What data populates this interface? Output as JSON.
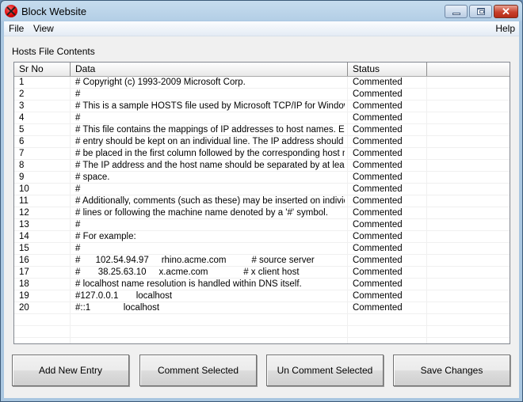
{
  "window": {
    "title": "Block Website",
    "icon": "block-icon",
    "controls": [
      "minimize-icon",
      "maximize-icon",
      "close-icon"
    ]
  },
  "menu": {
    "file": "File",
    "view": "View",
    "help": "Help"
  },
  "group_label": "Hosts File Contents",
  "table": {
    "columns": [
      "Sr No",
      "Data",
      "Status",
      ""
    ],
    "rows": [
      {
        "sr": "1",
        "data": "# Copyright (c) 1993-2009 Microsoft Corp.",
        "status": "Commented"
      },
      {
        "sr": "2",
        "data": "#",
        "status": "Commented"
      },
      {
        "sr": "3",
        "data": "# This is a sample HOSTS file used by Microsoft TCP/IP for Windows.",
        "status": "Commented"
      },
      {
        "sr": "4",
        "data": "#",
        "status": "Commented"
      },
      {
        "sr": "5",
        "data": "# This file contains the mappings of IP addresses to host names. Each",
        "status": "Commented"
      },
      {
        "sr": "6",
        "data": "# entry should be kept on an individual line. The IP address should",
        "status": "Commented"
      },
      {
        "sr": "7",
        "data": "# be placed in the first column followed by the corresponding host na...",
        "status": "Commented"
      },
      {
        "sr": "8",
        "data": "# The IP address and the host name should be separated by at least ...",
        "status": "Commented"
      },
      {
        "sr": "9",
        "data": "# space.",
        "status": "Commented"
      },
      {
        "sr": "10",
        "data": "#",
        "status": "Commented"
      },
      {
        "sr": "11",
        "data": "# Additionally, comments (such as these) may be inserted on individual",
        "status": "Commented"
      },
      {
        "sr": "12",
        "data": "# lines or following the machine name denoted by a '#' symbol.",
        "status": "Commented"
      },
      {
        "sr": "13",
        "data": "#",
        "status": "Commented"
      },
      {
        "sr": "14",
        "data": "# For example:",
        "status": "Commented"
      },
      {
        "sr": "15",
        "data": "#",
        "status": "Commented"
      },
      {
        "sr": "16",
        "data": "#      102.54.94.97     rhino.acme.com          # source server",
        "status": "Commented"
      },
      {
        "sr": "17",
        "data": "#       38.25.63.10     x.acme.com              # x client host",
        "status": "Commented"
      },
      {
        "sr": "18",
        "data": "# localhost name resolution is handled within DNS itself.",
        "status": "Commented"
      },
      {
        "sr": "19",
        "data": "#127.0.0.1       localhost",
        "status": "Commented"
      },
      {
        "sr": "20",
        "data": "#::1             localhost",
        "status": "Commented"
      }
    ]
  },
  "buttons": {
    "add": "Add New Entry",
    "comment": "Comment Selected",
    "uncomment": "Un Comment Selected",
    "save": "Save Changes"
  }
}
